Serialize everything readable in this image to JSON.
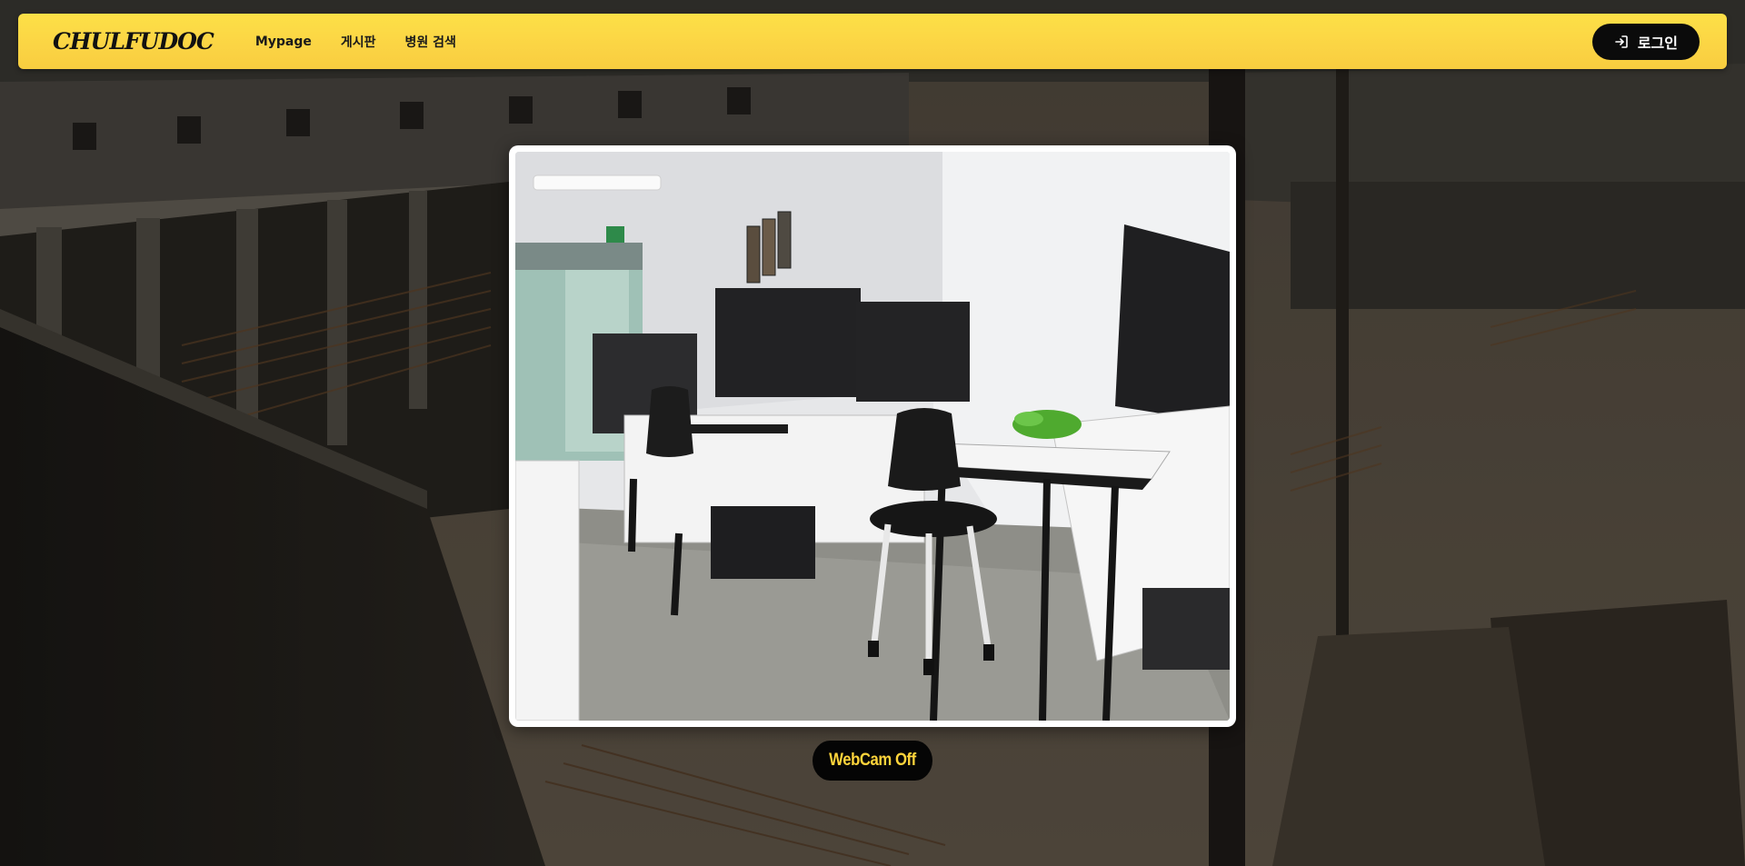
{
  "navbar": {
    "logo": "CHULFUDOC",
    "links": [
      "Mypage",
      "게시판",
      "병원 검색"
    ],
    "login_label": "로그인",
    "login_icon": "login-arrow-icon",
    "background_color": "#fcd84a"
  },
  "webcam": {
    "toggle_label": "WebCam Off",
    "toggle_text_color": "#ffd43b"
  }
}
